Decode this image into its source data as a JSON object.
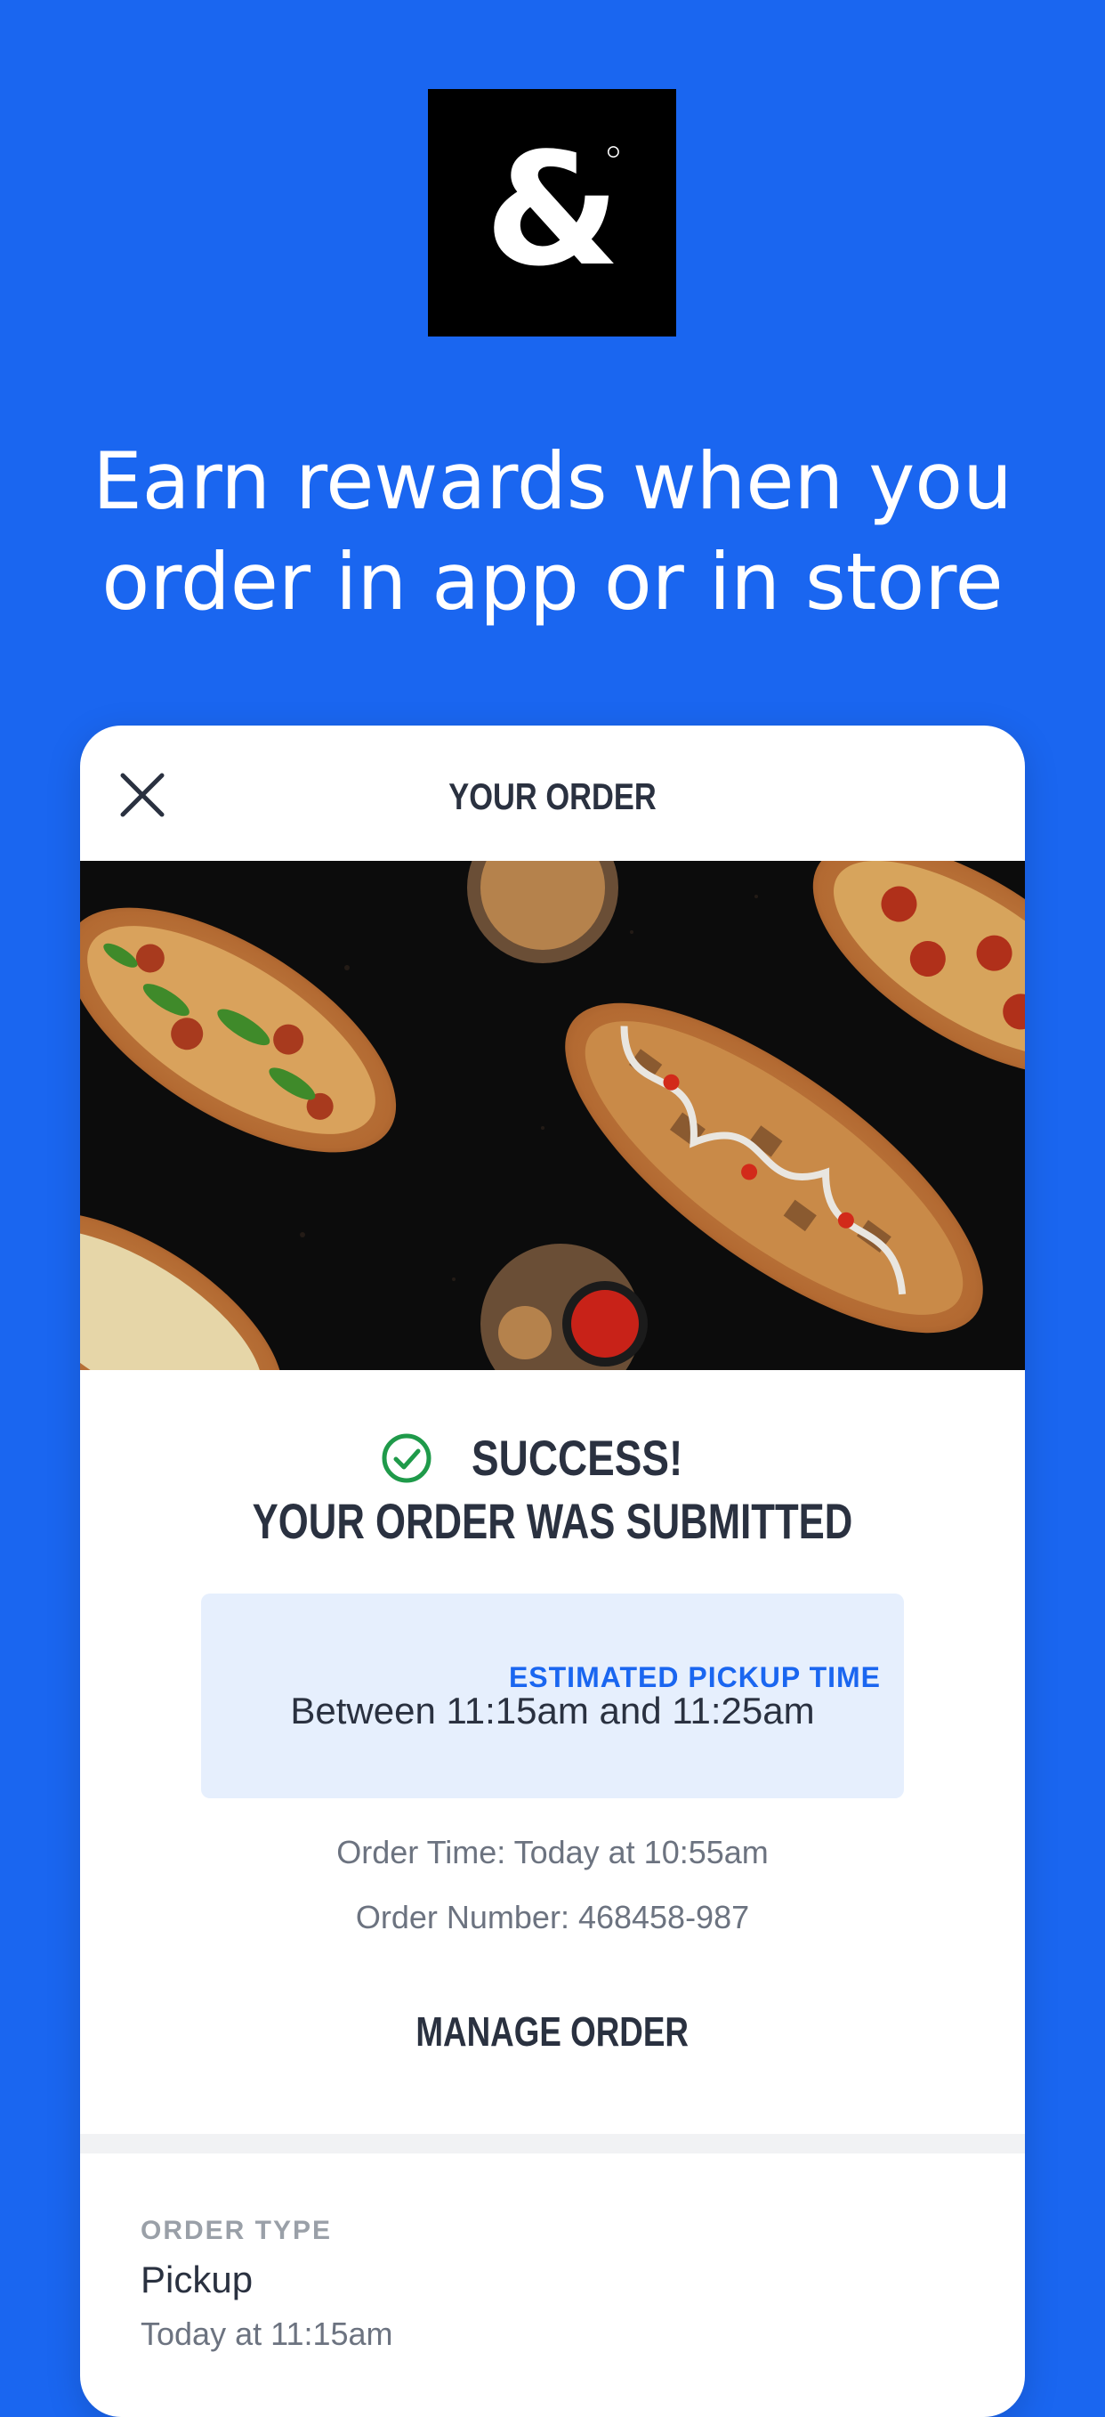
{
  "brand": {
    "logo_glyph": "&",
    "logo_icon": "ampersand-logo-icon",
    "background": "#1a66f0"
  },
  "headline": {
    "line1": "Earn rewards when you",
    "line2": "order in app or in store"
  },
  "order_card": {
    "title": "YOUR ORDER",
    "close_icon": "close-icon",
    "hero_image": "flatbread-pizzas-photo",
    "success": {
      "icon": "check-circle-icon",
      "line1": "SUCCESS!",
      "line2": "YOUR ORDER WAS SUBMITTED"
    },
    "pickup": {
      "label": "ESTIMATED PICKUP TIME",
      "value": "Between 11:15am and 11:25am"
    },
    "order_time": "Order Time: Today at 10:55am",
    "order_number": "Order Number: 468458-987",
    "manage_label": "MANAGE ORDER",
    "order_type": {
      "label": "ORDER TYPE",
      "value": "Pickup",
      "time": "Today at 11:15am"
    }
  },
  "colors": {
    "accent": "#1a66f0",
    "success": "#1f9a4a",
    "text_dark": "#2a3140",
    "pickup_bg": "#e6effd"
  }
}
